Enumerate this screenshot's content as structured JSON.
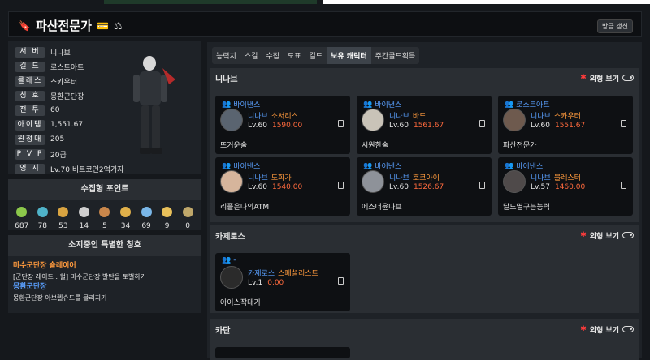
{
  "header": {
    "title": "파산전문가",
    "refresh_label": "방금 갱신"
  },
  "profile": {
    "rows": [
      {
        "label": "서 버",
        "value": "니나브"
      },
      {
        "label": "길 드",
        "value": "로스트아트"
      },
      {
        "label": "클래스",
        "value": "스카우터"
      },
      {
        "label": "칭 호",
        "value": "몽환군단장"
      },
      {
        "label": "전 투",
        "value": "60"
      },
      {
        "label": "아이템",
        "value": "1,551.67"
      },
      {
        "label": "원정대",
        "value": "205"
      },
      {
        "label": "P V P",
        "value": "20급"
      },
      {
        "label": "영 지",
        "value": "Lv.70 비트코인2억가자"
      }
    ]
  },
  "collectibles": {
    "title": "수집형 포인트",
    "items": [
      {
        "icon": "seed-icon",
        "value": "687",
        "color": "#8cc84b"
      },
      {
        "icon": "island-icon",
        "value": "78",
        "color": "#4fb3c9"
      },
      {
        "icon": "giant-heart-icon",
        "value": "53",
        "color": "#d9a441"
      },
      {
        "icon": "art-icon",
        "value": "14",
        "color": "#cfcfcf"
      },
      {
        "icon": "voyage-icon",
        "value": "5",
        "color": "#c9874b"
      },
      {
        "icon": "star-emblem-icon",
        "value": "34",
        "color": "#e0b04a"
      },
      {
        "icon": "world-tree-icon",
        "value": "69",
        "color": "#7ab7e8"
      },
      {
        "icon": "orpheus-star-icon",
        "value": "9",
        "color": "#e8c05a"
      },
      {
        "icon": "ignea-icon",
        "value": "0",
        "color": "#bfa76a"
      }
    ]
  },
  "titles": {
    "title": "소지중인 특별한 칭호",
    "items": [
      {
        "name": "마수군단장 슬레이어",
        "desc": "[군단장 레이드 : 혈] 마수군단장 발탄을 토벌하기"
      },
      {
        "name": "몽환군단장",
        "desc": "몽환군단장 아브렐슈드를 물리치기"
      }
    ]
  },
  "tabs": [
    "능력치",
    "스킬",
    "수집",
    "도표",
    "길드",
    "보유 캐릭터",
    "주간골드획득"
  ],
  "active_tab": "보유 캐릭터",
  "visibility_label": "외형 보기",
  "servers": [
    {
      "name": "니나브",
      "characters": [
        {
          "guild": "바이낸스",
          "server": "니나브",
          "class": "소서리스",
          "level": "Lv.60",
          "item_level": "1590.00",
          "name": "뜨거운술",
          "avatar_color": "#5a6470"
        },
        {
          "guild": "바이낸스",
          "server": "니나브",
          "class": "바드",
          "level": "Lv.60",
          "item_level": "1561.67",
          "name": "시원한술",
          "avatar_color": "#c9c3b8"
        },
        {
          "guild": "로스트아트",
          "server": "니나브",
          "class": "스카우터",
          "level": "Lv.60",
          "item_level": "1551.67",
          "name": "파산전문가",
          "avatar_color": "#6e5a4e"
        },
        {
          "guild": "바이낸스",
          "server": "니나브",
          "class": "도화가",
          "level": "Lv.60",
          "item_level": "1540.00",
          "name": "리플은나의ATM",
          "avatar_color": "#d6b59c"
        },
        {
          "guild": "바이낸스",
          "server": "니나브",
          "class": "호크아이",
          "level": "Lv.60",
          "item_level": "1526.67",
          "name": "에스더윤나브",
          "avatar_color": "#8e9299"
        },
        {
          "guild": "바이낸스",
          "server": "니나브",
          "class": "블레스터",
          "level": "Lv.57",
          "item_level": "1460.00",
          "name": "달도멸구는능력",
          "avatar_color": "#4f4a4a"
        }
      ]
    },
    {
      "name": "카제로스",
      "characters": [
        {
          "guild": "-",
          "server": "카제로스",
          "class": "스페셜리스트",
          "level": "Lv.1",
          "item_level": "0.00",
          "name": "아이스작대기",
          "avatar_color": "#2b2b2b"
        }
      ]
    },
    {
      "name": "카단",
      "characters": []
    }
  ]
}
